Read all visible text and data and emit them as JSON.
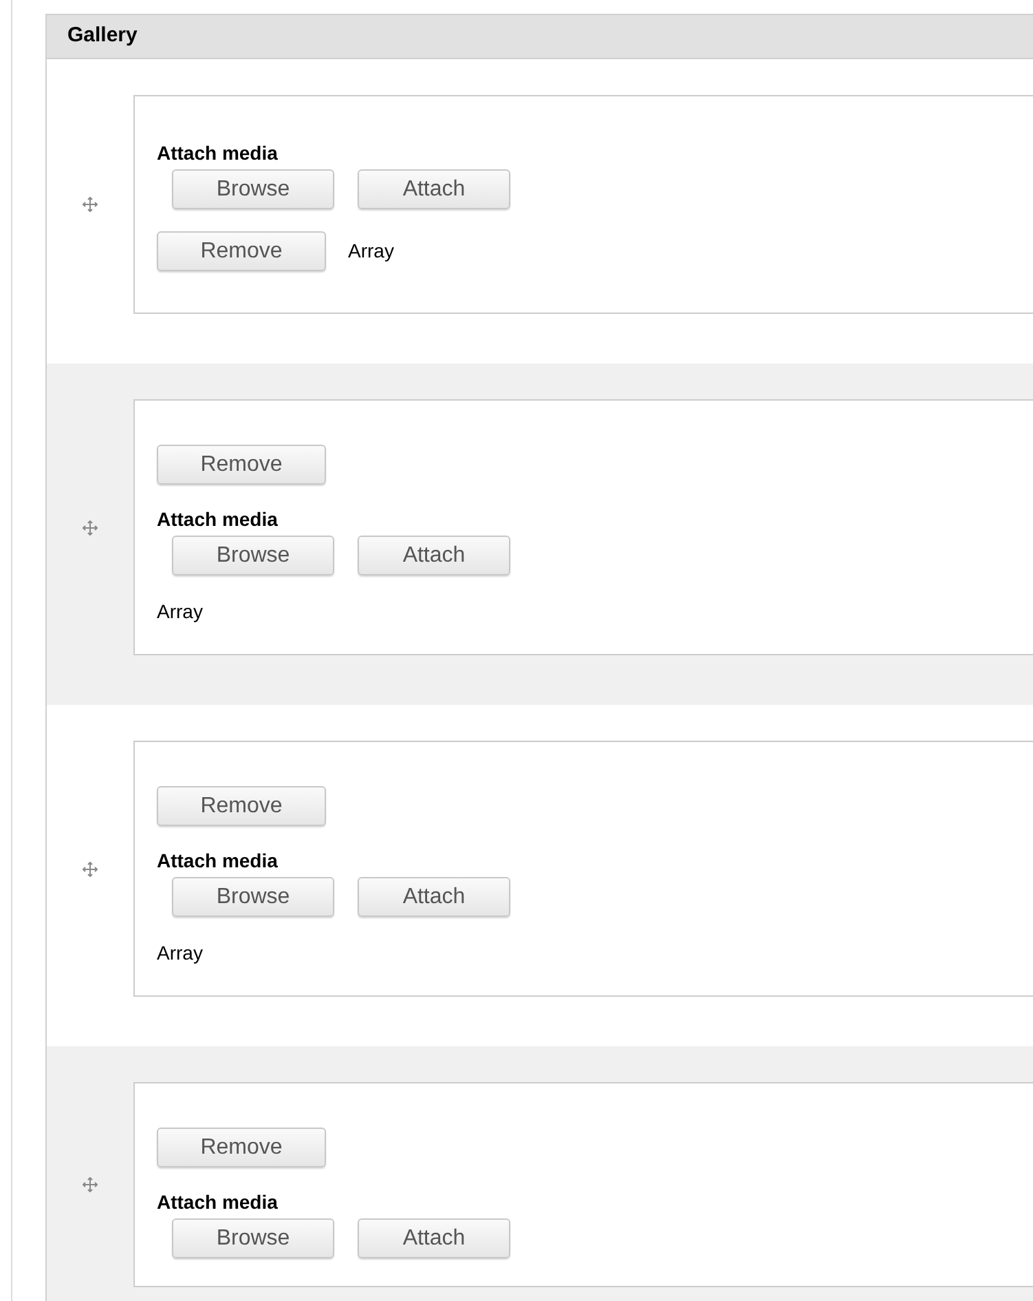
{
  "table": {
    "title": "Gallery",
    "rows": [
      {
        "parts": [
          {
            "kind": "media",
            "label": "Attach media",
            "buttons": [
              "Browse",
              "Attach"
            ]
          },
          {
            "kind": "remove",
            "button": "Remove",
            "note": "Array"
          }
        ]
      },
      {
        "parts": [
          {
            "kind": "remove",
            "button": "Remove"
          },
          {
            "kind": "media",
            "label": "Attach media",
            "buttons": [
              "Browse",
              "Attach"
            ]
          },
          {
            "kind": "text",
            "text": "Array"
          }
        ]
      },
      {
        "parts": [
          {
            "kind": "remove",
            "button": "Remove"
          },
          {
            "kind": "media",
            "label": "Attach media",
            "buttons": [
              "Browse",
              "Attach"
            ]
          },
          {
            "kind": "text",
            "text": "Array"
          }
        ]
      },
      {
        "parts": [
          {
            "kind": "remove",
            "button": "Remove"
          },
          {
            "kind": "media",
            "label": "Attach media",
            "buttons": [
              "Browse",
              "Attach"
            ]
          }
        ]
      }
    ]
  }
}
